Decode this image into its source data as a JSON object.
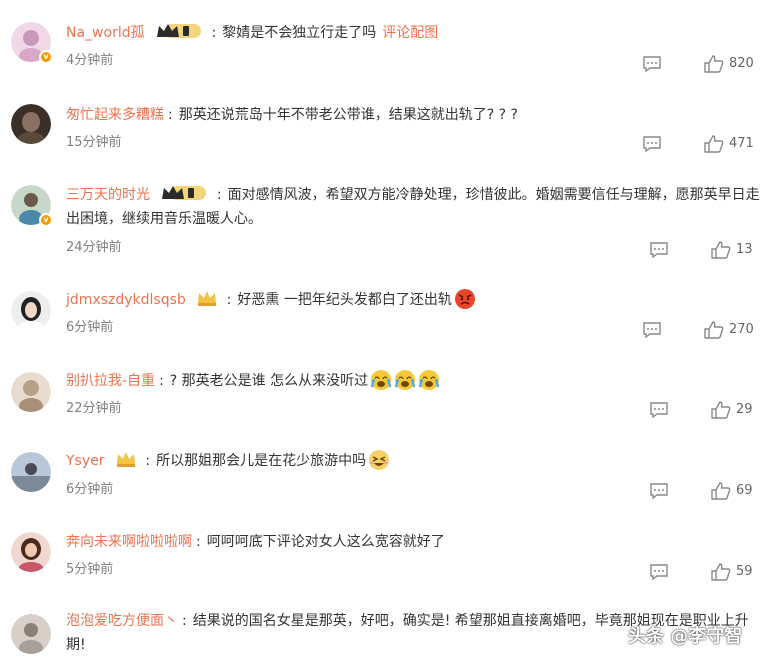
{
  "comments": [
    {
      "username": "Na_world孤",
      "text": "黎婧是不会独立行走了吗",
      "link": "评论配图",
      "time": "4分钟前",
      "likes": "820",
      "avatar_color": "#d8a8c8",
      "verified": true,
      "badge": "crown-level-1"
    },
    {
      "username": "匆忙起来多糟糕",
      "text": "那英还说荒岛十年不带老公带谁，结果这就出轨了? ? ?",
      "time": "15分钟前",
      "likes": "471",
      "avatar_color": "#5a4a3a",
      "verified": false
    },
    {
      "username": "三万天的时光",
      "text": "面对感情风波，希望双方能冷静处理，珍惜彼此。婚姻需要信任与理解，愿那英早日走出困境，继续用音乐温暖人心。",
      "time": "24分钟前",
      "likes": "13",
      "avatar_color": "#7a9a8a",
      "verified": true,
      "badge": "crown-level-1"
    },
    {
      "username": "jdmxszdykdlsqsb",
      "text": "好恶熏 一把年纪头发都白了还出轨",
      "time": "6分钟前",
      "likes": "270",
      "avatar_color": "#e0d0d8",
      "verified": false,
      "badge": "crown-small"
    },
    {
      "username": "别扒拉我-自重",
      "text": "? 那英老公是谁 怎么从来没听过",
      "time": "22分钟前",
      "likes": "29",
      "avatar_color": "#c8b8a8",
      "verified": false
    },
    {
      "username": "Ysyer",
      "text": "所以那姐那会儿是在花少旅游中吗",
      "time": "6分钟前",
      "likes": "69",
      "avatar_color": "#9aa8b8",
      "verified": false,
      "badge": "crown-small"
    },
    {
      "username": "奔向未来啊啦啦啦啊",
      "text": "呵呵呵底下评论对女人这么宽容就好了",
      "time": "5分钟前",
      "likes": "59",
      "avatar_color": "#c88878",
      "verified": false
    },
    {
      "username": "泡泡爱吃方便面丶",
      "text": "结果说的国名女星是那英，好吧，确实是! 希望那姐直接离婚吧，毕竟那姐现在是职业上升期!",
      "time": "",
      "likes": "",
      "avatar_color": "#b8b0a8",
      "verified": false
    }
  ],
  "watermark": "头条 @李守智",
  "colors": {
    "username": "#eb7350",
    "text": "#333333",
    "time": "#808080",
    "icon": "#888888"
  }
}
